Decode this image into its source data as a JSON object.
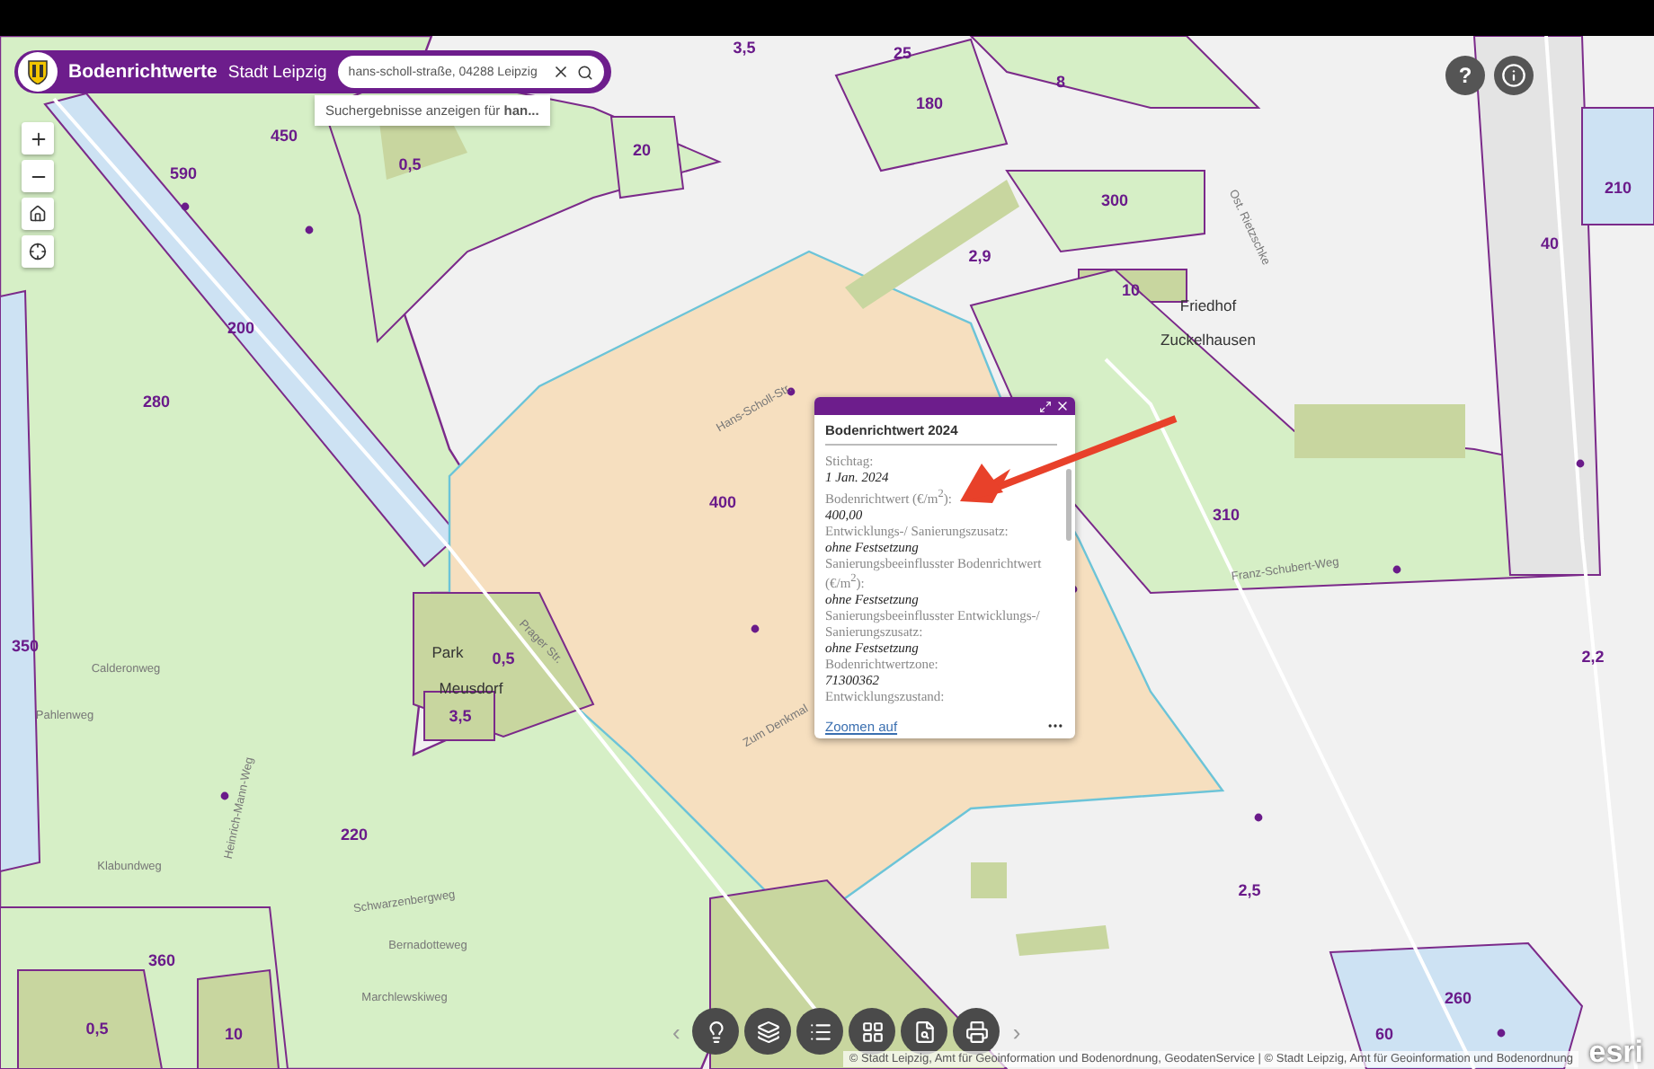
{
  "header": {
    "title": "Bodenrichtwerte",
    "subtitle": "Stadt Leipzig",
    "search": {
      "value": "hans-scholl-straße, 04288 Leipzig"
    },
    "suggestion": "Suchergebnisse anzeigen für **han...**"
  },
  "help_button": "?",
  "map_labels": [
    {
      "text": "3,5",
      "kind": "value"
    },
    {
      "text": "25",
      "kind": "value"
    },
    {
      "text": "8",
      "kind": "value"
    },
    {
      "text": "180",
      "kind": "value"
    },
    {
      "text": "450",
      "kind": "value"
    },
    {
      "text": "590",
      "kind": "value"
    },
    {
      "text": "0,5",
      "kind": "value"
    },
    {
      "text": "20",
      "kind": "value"
    },
    {
      "text": "300",
      "kind": "value"
    },
    {
      "text": "2,9",
      "kind": "value"
    },
    {
      "text": "10",
      "kind": "value"
    },
    {
      "text": "40",
      "kind": "value"
    },
    {
      "text": "210",
      "kind": "value"
    },
    {
      "text": "200",
      "kind": "value"
    },
    {
      "text": "280",
      "kind": "value"
    },
    {
      "text": "400",
      "kind": "value"
    },
    {
      "text": "310",
      "kind": "value"
    },
    {
      "text": "2,2",
      "kind": "value"
    },
    {
      "text": "350",
      "kind": "value"
    },
    {
      "text": "0,5",
      "kind": "value"
    },
    {
      "text": "3,5",
      "kind": "value"
    },
    {
      "text": "220",
      "kind": "value"
    },
    {
      "text": "360",
      "kind": "value"
    },
    {
      "text": "0,5",
      "kind": "value"
    },
    {
      "text": "10",
      "kind": "value"
    },
    {
      "text": "2,5",
      "kind": "value"
    },
    {
      "text": "260",
      "kind": "value"
    },
    {
      "text": "60",
      "kind": "value"
    },
    {
      "text": "Friedhof",
      "kind": "place"
    },
    {
      "text": "Zuckelhausen",
      "kind": "place"
    },
    {
      "text": "Park",
      "kind": "place"
    },
    {
      "text": "Meusdorf",
      "kind": "place"
    },
    {
      "text": "Hans-Scholl-Str.",
      "kind": "street"
    },
    {
      "text": "Prager Str.",
      "kind": "street"
    },
    {
      "text": "Zum Denkmal",
      "kind": "street"
    },
    {
      "text": "Franz-Schubert-Weg",
      "kind": "street"
    },
    {
      "text": "Pahlenweg",
      "kind": "street"
    },
    {
      "text": "Calderonweg",
      "kind": "street"
    },
    {
      "text": "Klabundweg",
      "kind": "street"
    },
    {
      "text": "Schwarzenbergweg",
      "kind": "street"
    },
    {
      "text": "Bernadotteweg",
      "kind": "street"
    },
    {
      "text": "Marchlewskiweg",
      "kind": "street"
    },
    {
      "text": "Heinrich-Mann-Weg",
      "kind": "street"
    },
    {
      "text": "Ost. Rietzschke",
      "kind": "street"
    }
  ],
  "popup": {
    "title": "Bodenrichtwert 2024",
    "fields": [
      {
        "label": "Stichtag:",
        "value": "1 Jan. 2024"
      },
      {
        "label": "Bodenrichtwert (€/m$^{2}$):",
        "value": "400,00"
      },
      {
        "label": "Entwicklungs-/ Sanierungszusatz:",
        "value": "ohne Festsetzung"
      },
      {
        "label": "Sanierungsbeeinflusster Bodenrichtwert (€/m$^{2}$):",
        "value": "ohne Festsetzung"
      },
      {
        "label": "Sanierungsbeeinflusster Entwicklungs-/ Sanierungszusatz:",
        "value": "ohne Festsetzung"
      },
      {
        "label": "Bodenrichtwertzone:",
        "value": "71300362"
      },
      {
        "label": "Entwicklungszustand:"
      }
    ],
    "link": "Zoomen auf"
  },
  "toolbar": {
    "prev": "‹",
    "next": "›"
  },
  "attribution": "© Stadt Leipzig, Amt für Geoinformation und Bodenordnung, GeodatenService | © Stadt Leipzig, Amt für Geoinformation und Bodenordnung",
  "logo": "esri"
}
